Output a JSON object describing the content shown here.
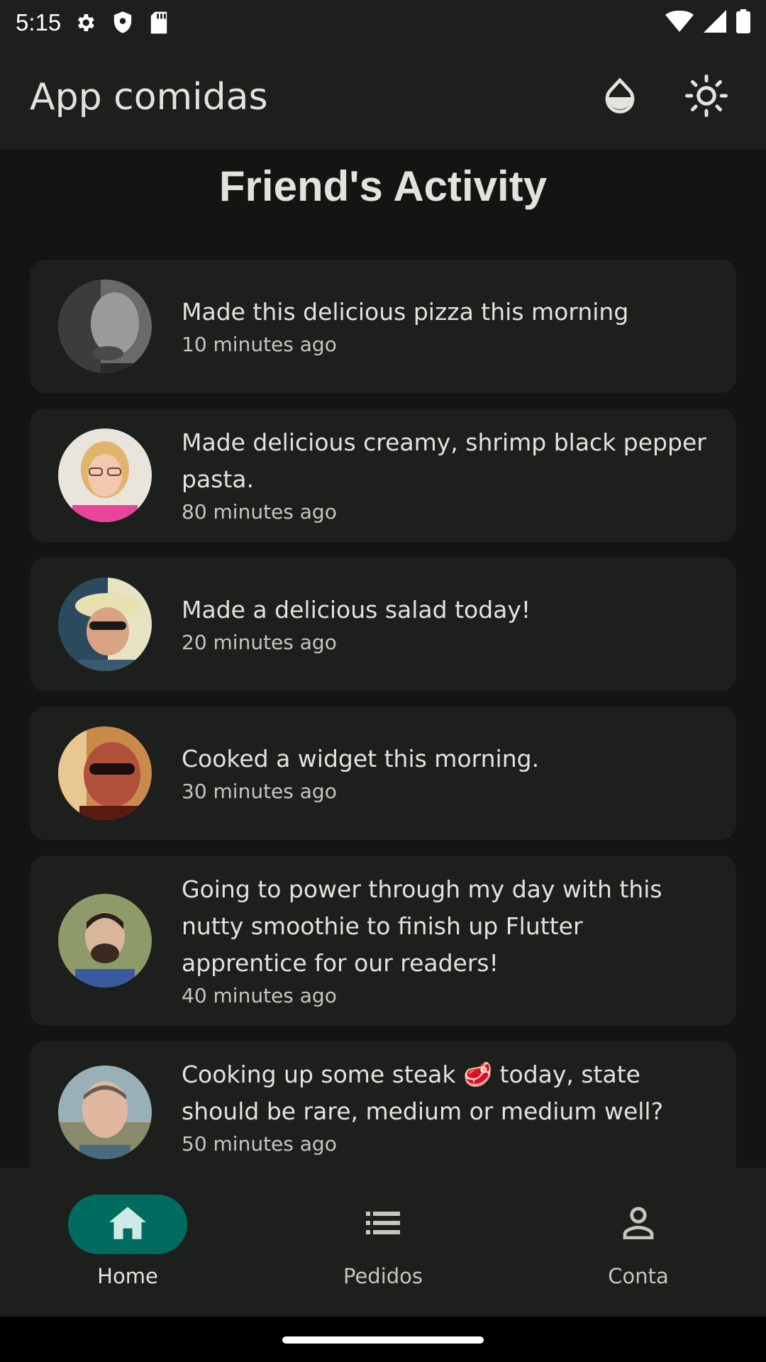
{
  "status_bar": {
    "time": "5:15",
    "left_icons": [
      "settings-icon",
      "shield-icon",
      "sd-card-icon"
    ],
    "right_icons": [
      "wifi-icon",
      "signal-icon",
      "battery-icon"
    ]
  },
  "app_bar": {
    "title": "App comidas",
    "actions": [
      "water-drop-icon",
      "light-mode-icon"
    ]
  },
  "page": {
    "title": "Friend's Activity"
  },
  "activity": [
    {
      "title": "Made this delicious pizza this morning",
      "time": "10 minutes ago"
    },
    {
      "title": "Made delicious creamy, shrimp black pepper pasta.",
      "time": "80 minutes ago"
    },
    {
      "title": "Made a delicious salad today!",
      "time": "20 minutes ago"
    },
    {
      "title": "Cooked a widget this morning.",
      "time": "30 minutes ago"
    },
    {
      "title": "Going to power through my day with this nutty smoothie to finish up Flutter apprentice for our readers!",
      "time": "40 minutes ago"
    },
    {
      "title": "Cooking up some steak 🥩 today, state should be rare, medium or medium well?",
      "time": "50 minutes ago"
    }
  ],
  "bottom_nav": {
    "items": [
      {
        "label": "Home",
        "icon": "home-icon",
        "active": true
      },
      {
        "label": "Pedidos",
        "icon": "list-icon",
        "active": false
      },
      {
        "label": "Conta",
        "icon": "person-icon",
        "active": false
      }
    ]
  },
  "colors": {
    "background": "#131512",
    "surface": "#1c1f1b",
    "active_indicator": "#006b5f",
    "on_surface": "#e1e4dc"
  }
}
